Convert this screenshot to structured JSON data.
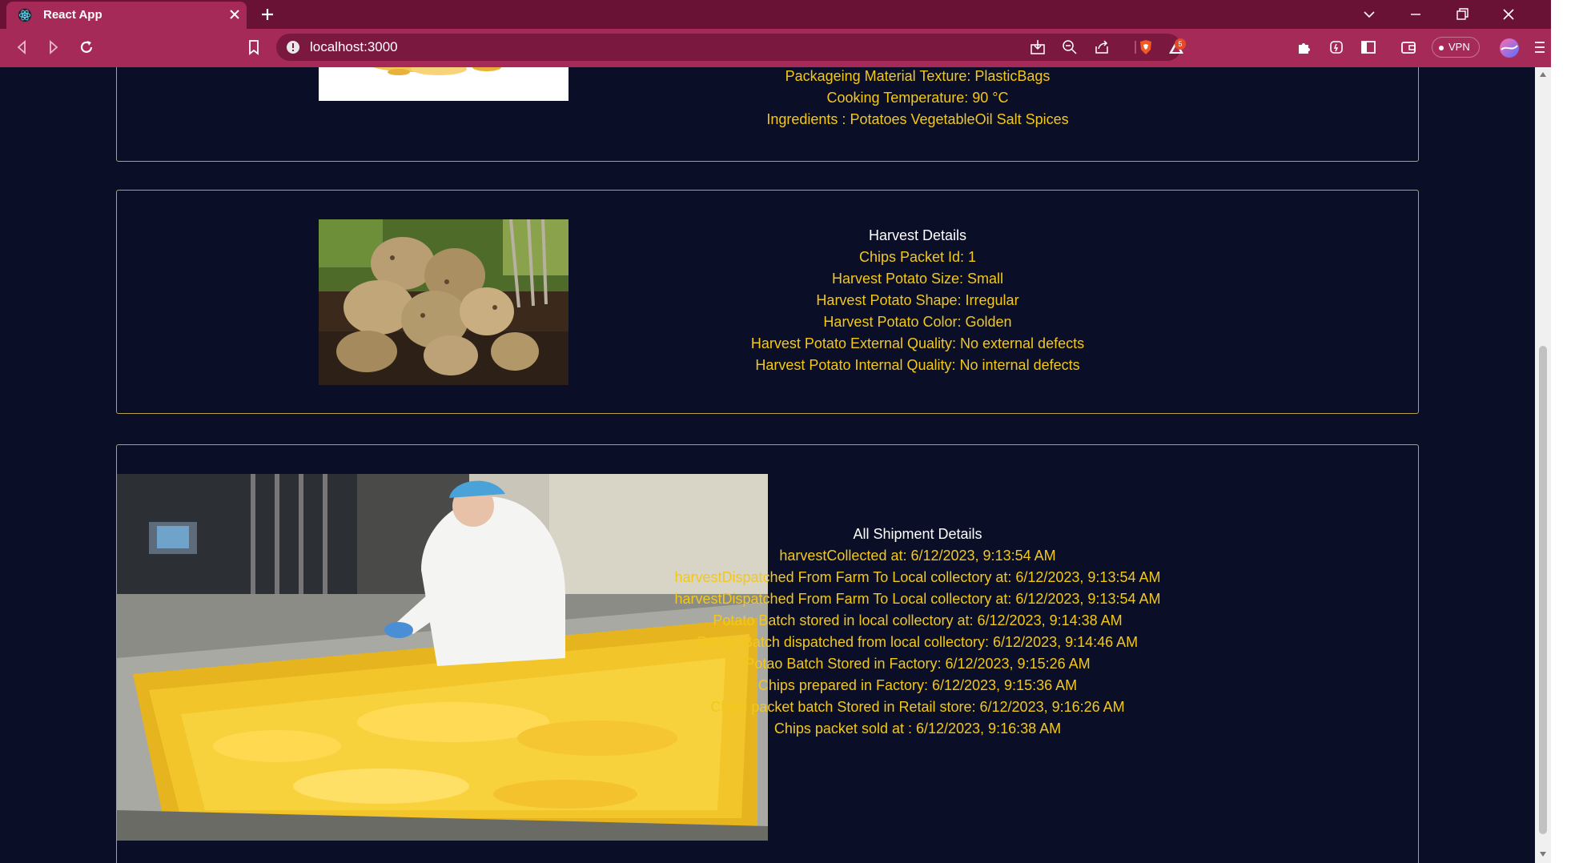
{
  "browser": {
    "tab_title": "React App",
    "url": "localhost:3000",
    "vpn_label": "VPN",
    "notification_count": "5"
  },
  "colors": {
    "page_background": "#0a0e26",
    "card_border": "#b9a24a",
    "detail_text": "#f3c81b",
    "title_text": "#ffffff",
    "tab_bar": "#6a1236",
    "toolbar": "#a52a57"
  },
  "processing_card": {
    "lines": [
      "Packageing Material Texture: PlasticBags",
      "Cooking Temperature: 90 °C",
      "Ingredients : Potatoes VegetableOil Salt Spices"
    ]
  },
  "harvest_card": {
    "title": "Harvest Details",
    "lines": [
      "Chips Packet Id: 1",
      "Harvest Potato Size: Small",
      "Harvest Potato Shape: Irregular",
      "Harvest Potato Color: Golden",
      "Harvest Potato External Quality: No external defects",
      "Harvest Potato Internal Quality: No internal defects"
    ]
  },
  "shipment_card": {
    "title": "All Shipment Details",
    "lines": [
      "harvestCollected at: 6/12/2023, 9:13:54 AM",
      "harvestDispatched From Farm To Local collectory at: 6/12/2023, 9:13:54 AM",
      "harvestDispatched From Farm To Local collectory at: 6/12/2023, 9:13:54 AM",
      "Potato Batch stored in local collectory at: 6/12/2023, 9:14:38 AM",
      "Potato Batch dispatched from local collectory: 6/12/2023, 9:14:46 AM",
      "Potao Batch Stored in Factory: 6/12/2023, 9:15:26 AM",
      "Chips prepared in Factory: 6/12/2023, 9:15:36 AM",
      "Chips packet batch Stored in Retail store: 6/12/2023, 9:16:26 AM",
      "Chips packet sold at : 6/12/2023, 9:16:38 AM"
    ]
  }
}
